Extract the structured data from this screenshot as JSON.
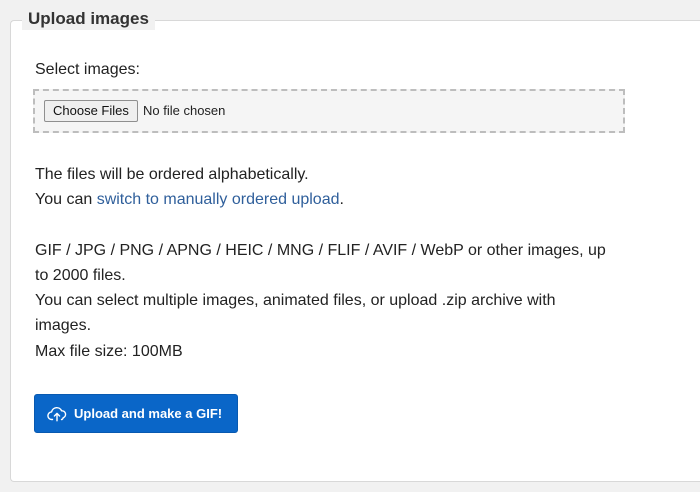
{
  "section": {
    "legend": "Upload images"
  },
  "file_input": {
    "label": "Select images:",
    "button_label": "Choose Files",
    "status": "No file chosen"
  },
  "ordering": {
    "line1": "The files will be ordered alphabetically.",
    "line2_prefix": "You can ",
    "line2_link": "switch to manually ordered upload",
    "line2_suffix": "."
  },
  "info": {
    "line1": "GIF / JPG / PNG / APNG / HEIC / MNG / FLIF / AVIF / WebP or other images, up",
    "line2": "to 2000 files.",
    "line3": "You can select multiple images, animated files, or upload .zip archive with",
    "line4": "images.",
    "line5": "Max file size: 100MB"
  },
  "submit": {
    "label": "Upload and make a GIF!",
    "icon": "cloud-upload-icon"
  },
  "colors": {
    "primary": "#0a66c8",
    "link": "#2f5f9b",
    "background": "#f1f1f1",
    "panel": "#ffffff"
  }
}
